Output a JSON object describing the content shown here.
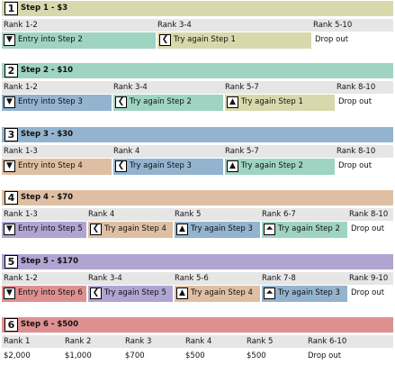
{
  "colors": {
    "s1": "#d8d8ad",
    "s2": "#9fd3c2",
    "s3": "#93b3ce",
    "s4": "#dfbfa3",
    "s5": "#b0a4d3",
    "s6": "#de9090",
    "green": "#9fd3c2",
    "khaki": "#d8d8ad",
    "blue": "#93b3ce",
    "tan": "#dfbfa3",
    "purple": "#b0a4d3",
    "pink": "#de9090"
  },
  "steps": [
    {
      "num": "1",
      "header": "Step 1 - $3",
      "ranks": [
        "Rank 1-2",
        "Rank 3-4",
        "Rank 5-10"
      ],
      "actions": [
        {
          "icon": "arrow-down-icon",
          "glyph": "▼",
          "label": "Entry into Step 2"
        },
        {
          "icon": "arrow-left-icon",
          "glyph": "❮",
          "label": "Try again Step 1"
        },
        {
          "icon": "",
          "glyph": "",
          "label": "Drop out"
        }
      ]
    },
    {
      "num": "2",
      "header": "Step 2 - $10",
      "ranks": [
        "Rank 1-2",
        "Rank 3-4",
        "Rank 5-7",
        "Rank 8-10"
      ],
      "actions": [
        {
          "icon": "arrow-down-icon",
          "glyph": "▼",
          "label": "Entry into Step 3"
        },
        {
          "icon": "arrow-left-icon",
          "glyph": "❮",
          "label": "Try again Step 2"
        },
        {
          "icon": "arrow-up-icon",
          "glyph": "▲",
          "label": "Try again Step 1"
        },
        {
          "icon": "",
          "glyph": "",
          "label": "Drop out"
        }
      ]
    },
    {
      "num": "3",
      "header": "Step 3 - $30",
      "ranks": [
        "Rank 1-3",
        "Rank 4",
        "Rank 5-7",
        "Rank 8-10"
      ],
      "actions": [
        {
          "icon": "arrow-down-icon",
          "glyph": "▼",
          "label": "Entry into Step 4"
        },
        {
          "icon": "arrow-left-icon",
          "glyph": "❮",
          "label": "Try again Step 3"
        },
        {
          "icon": "arrow-up-icon",
          "glyph": "▲",
          "label": "Try again Step 2"
        },
        {
          "icon": "",
          "glyph": "",
          "label": "Drop out"
        }
      ]
    },
    {
      "num": "4",
      "header": "Step 4 - $70",
      "ranks": [
        "Rank 1-3",
        "Rank 4",
        "Rank 5",
        "Rank 6-7",
        "Rank 8-10"
      ],
      "actions": [
        {
          "icon": "arrow-down-icon",
          "glyph": "▼",
          "label": "Entry into Step 5"
        },
        {
          "icon": "arrow-left-icon",
          "glyph": "❮",
          "label": "Try again Step 4"
        },
        {
          "icon": "arrow-up-icon",
          "glyph": "▲",
          "label": "Try again Step 3"
        },
        {
          "icon": "double-arrow-up-icon",
          "glyph": "⏶",
          "label": "Try again Step 2"
        },
        {
          "icon": "",
          "glyph": "",
          "label": "Drop out"
        }
      ]
    },
    {
      "num": "5",
      "header": "Step 5 - $170",
      "ranks": [
        "Rank 1-2",
        "Rank 3-4",
        "Rank 5-6",
        "Rank 7-8",
        "Rank 9-10"
      ],
      "actions": [
        {
          "icon": "arrow-down-icon",
          "glyph": "▼",
          "label": "Entry into Step 6"
        },
        {
          "icon": "arrow-left-icon",
          "glyph": "❮",
          "label": "Try again Step 5"
        },
        {
          "icon": "arrow-up-icon",
          "glyph": "▲",
          "label": "Try again Step 4"
        },
        {
          "icon": "double-arrow-up-icon",
          "glyph": "⏶",
          "label": "Try again Step 3"
        },
        {
          "icon": "",
          "glyph": "",
          "label": "Drop out"
        }
      ]
    },
    {
      "num": "6",
      "header": "Step 6 - $500",
      "ranks": [
        "Rank 1",
        "Rank 2",
        "Rank 3",
        "Rank 4",
        "Rank 5",
        "Rank 6-10"
      ],
      "values": [
        "$2,000",
        "$1,000",
        "$700",
        "$500",
        "$500",
        "Drop out"
      ]
    }
  ]
}
